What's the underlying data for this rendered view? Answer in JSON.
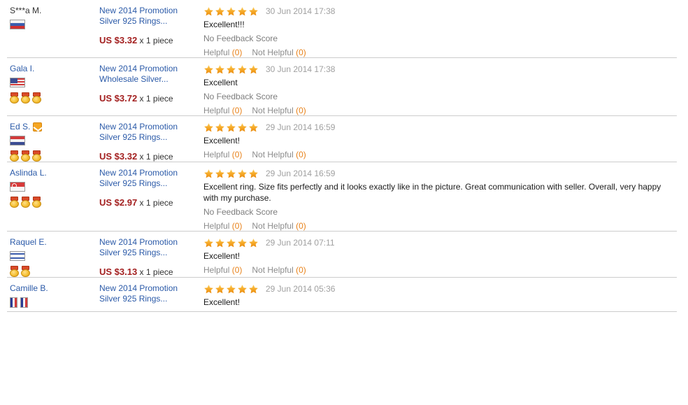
{
  "colors": {
    "link": "#2b5aa8",
    "price": "#a32020",
    "star": "#f5a623",
    "count_orange": "#e8821a",
    "date_gray": "#a0a0a0",
    "separator": "#cccccc"
  },
  "labels": {
    "helpful": "Helpful",
    "not_helpful": "Not Helpful",
    "no_feedback_score": "No Feedback Score",
    "quantity_suffix": "x 1 piece"
  },
  "rows": [
    {
      "buyer": "S***a M.",
      "buyer_is_link": false,
      "verified_badge": false,
      "flags": [
        "flag-ru"
      ],
      "medals": 0,
      "item_title": "New 2014 Promotion Silver 925 Rings...",
      "price": "US $3.32",
      "quantity": "x 1 piece",
      "stars": 5,
      "date": "30 Jun 2014 17:38",
      "comment": "Excellent!!!",
      "feedback_score": "No Feedback Score",
      "helpful": "Helpful (0)",
      "not_helpful": "Not Helpful (0)",
      "helpful_count": "(0)",
      "not_helpful_count": "(0)"
    },
    {
      "buyer": "Gala I.",
      "buyer_is_link": true,
      "verified_badge": false,
      "flags": [
        "flag-us"
      ],
      "medals": 3,
      "item_title": "New 2014 Promotion Wholesale Silver...",
      "price": "US $3.72",
      "quantity": "x 1 piece",
      "stars": 5,
      "date": "30 Jun 2014 17:38",
      "comment": "Excellent",
      "feedback_score": "No Feedback Score",
      "helpful": "Helpful (0)",
      "not_helpful": "Not Helpful (0)",
      "helpful_count": "(0)",
      "not_helpful_count": "(0)"
    },
    {
      "buyer": "Ed S.",
      "buyer_is_link": true,
      "verified_badge": true,
      "flags": [
        "flag-nl"
      ],
      "medals": 3,
      "item_title": "New 2014 Promotion Silver 925 Rings...",
      "price": "US $3.32",
      "quantity": "x 1 piece",
      "stars": 5,
      "date": "29 Jun 2014 16:59",
      "comment": "Excellent!",
      "feedback_score": "",
      "helpful": "Helpful (0)",
      "not_helpful": "Not Helpful (0)",
      "helpful_count": "(0)",
      "not_helpful_count": "(0)"
    },
    {
      "buyer": "Aslinda L.",
      "buyer_is_link": true,
      "verified_badge": false,
      "flags": [
        "flag-sg"
      ],
      "medals": 3,
      "item_title": "New 2014 Promotion Silver 925 Rings...",
      "price": "US $2.97",
      "quantity": "x 1 piece",
      "stars": 5,
      "date": "29 Jun 2014 16:59",
      "comment": "Excellent ring. Size fits perfectly and it looks exactly like in the picture. Great communication with seller. Overall, very happy with my purchase.",
      "feedback_score": "No Feedback Score",
      "helpful": "Helpful (0)",
      "not_helpful": "Not Helpful (0)",
      "helpful_count": "(0)",
      "not_helpful_count": "(0)"
    },
    {
      "buyer": "Raquel E.",
      "buyer_is_link": true,
      "verified_badge": false,
      "flags": [
        "flag-il"
      ],
      "medals": 2,
      "item_title": "New 2014 Promotion Silver 925 Rings...",
      "price": "US $3.13",
      "quantity": "x 1 piece",
      "stars": 5,
      "date": "29 Jun 2014 07:11",
      "comment": "Excellent!",
      "feedback_score": "",
      "helpful": "Helpful (0)",
      "not_helpful": "Not Helpful (0)",
      "helpful_count": "(0)",
      "not_helpful_count": "(0)"
    },
    {
      "buyer": "Camille B.",
      "buyer_is_link": true,
      "verified_badge": false,
      "flags": [
        "flag-fr",
        "flag-fr"
      ],
      "medals": 0,
      "item_title": "New 2014 Promotion Silver 925 Rings...",
      "price": "",
      "quantity": "",
      "stars": 5,
      "date": "29 Jun 2014 05:36",
      "comment": "Excellent!",
      "feedback_score": "",
      "helpful": "",
      "not_helpful": "",
      "helpful_count": "",
      "not_helpful_count": ""
    }
  ]
}
